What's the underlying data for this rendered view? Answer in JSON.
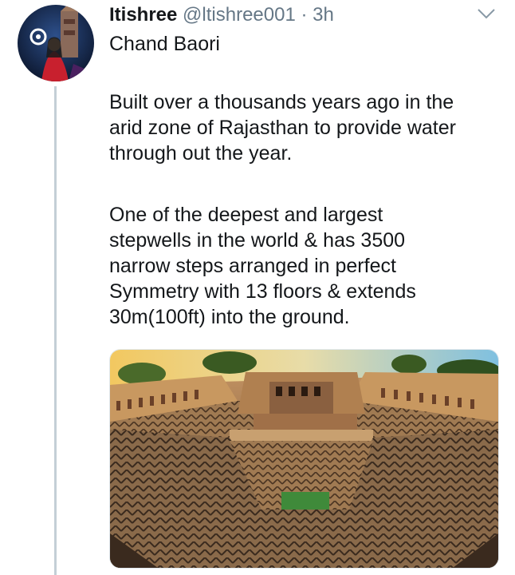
{
  "tweet": {
    "display_name": "Itishree",
    "handle": "@ltishree001",
    "separator": "·",
    "time": "3h",
    "title": "Chand Baori",
    "paragraph1": "Built over a thousands years ago in the\narid zone of Rajasthan to provide water\nthrough out the year.",
    "paragraph2": "One of the deepest and largest\nstepwells in the world & has 3500\nnarrow steps arranged in perfect\nSymmetry with 13 floors & extends\n30m(100ft) into the ground."
  },
  "icons": {
    "menu": "chevron-down-icon"
  },
  "colors": {
    "text": "#14171a",
    "secondary": "#657786",
    "thread_line": "#c4cfd6"
  }
}
